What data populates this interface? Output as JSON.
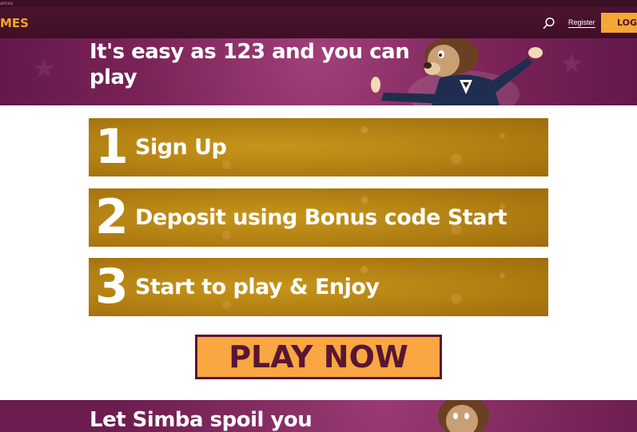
{
  "topstrip": {
    "text": "ames"
  },
  "header": {
    "logo_text": "MES",
    "register_label": "Register",
    "login_label": "LOGI"
  },
  "hero": {
    "title_line1": "It's easy as 123 and you can",
    "title_line2": "play"
  },
  "steps": [
    {
      "number": "1",
      "text": "Sign Up"
    },
    {
      "number": "2",
      "text": "Deposit using Bonus code Start"
    },
    {
      "number": "3",
      "text": "Start to play & Enjoy"
    }
  ],
  "cta": {
    "label": "PLAY NOW"
  },
  "bottom_banner": {
    "title": "Let Simba spoil you"
  },
  "colors": {
    "accent_orange": "#f6a634",
    "header_bg": "#4d1430",
    "banner_purple": "#7a2357",
    "step_gold": "#b68414",
    "cta_text": "#5a1533"
  },
  "icons": [
    "search-icon",
    "mascot-image"
  ]
}
